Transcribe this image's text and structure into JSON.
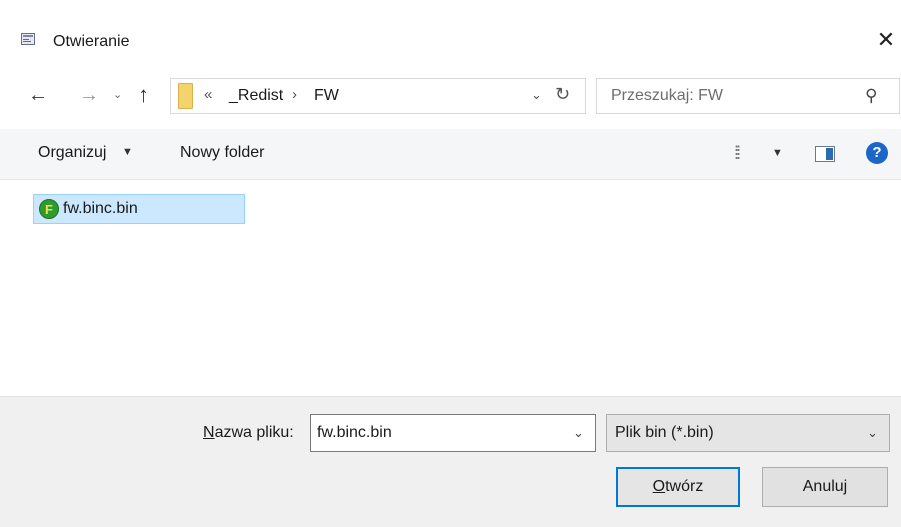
{
  "window": {
    "title": "Otwieranie",
    "close_glyph": "✕"
  },
  "nav": {
    "back_glyph": "←",
    "forward_glyph": "→",
    "recent_glyph": "⌄",
    "up_glyph": "↑"
  },
  "address": {
    "overflow_glyph": "«",
    "crumbs": [
      "_Redist",
      "FW"
    ],
    "separator": "›",
    "dropdown_glyph": "⌄",
    "refresh_glyph": "↻"
  },
  "search": {
    "placeholder": "Przeszukaj: FW"
  },
  "toolbar": {
    "organize_label": "Organizuj",
    "new_folder_label": "Nowy folder",
    "caret_glyph": "▼",
    "view_glyph": "⁞⁞",
    "help_glyph": "?"
  },
  "files": [
    {
      "name": "fw.binc.bin",
      "icon_letter": "F",
      "selected": true
    }
  ],
  "bottom": {
    "filename_label_underlined": "N",
    "filename_label_rest": "azwa pliku:",
    "filename_value": "fw.binc.bin",
    "filetype_value": "Plik bin (*.bin)",
    "dropdown_glyph": "⌄",
    "open_label_underlined": "O",
    "open_label_rest": "twórz",
    "cancel_label": "Anuluj"
  }
}
